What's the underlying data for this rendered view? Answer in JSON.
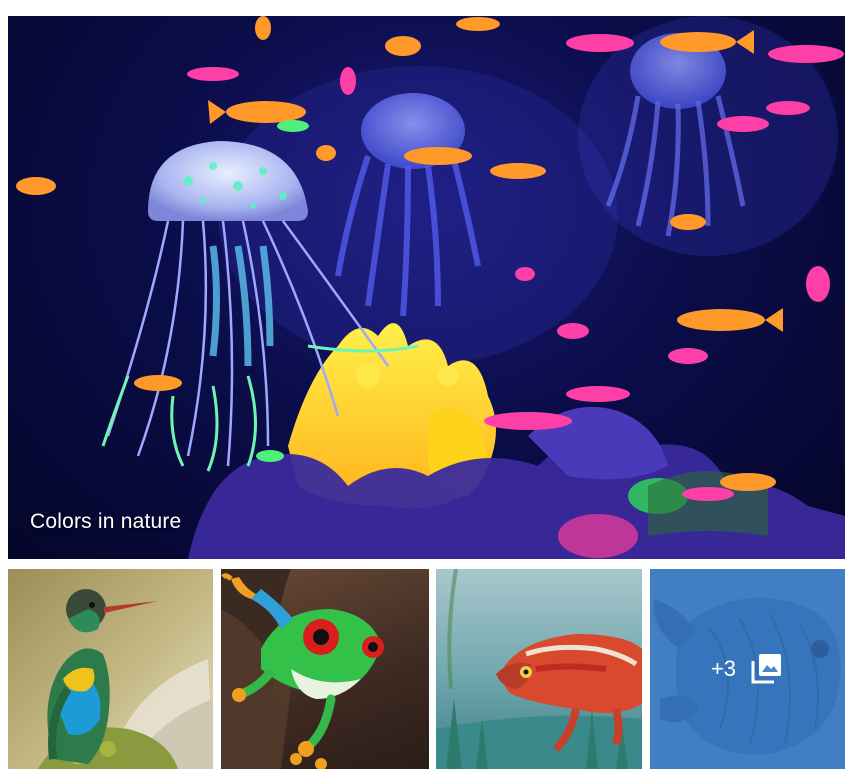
{
  "album": {
    "caption": "Colors in nature",
    "hero_image": "jellyfish-aquarium-photo",
    "thumbnails": [
      {
        "subject": "hummingbird-photo"
      },
      {
        "subject": "tree-frog-photo"
      },
      {
        "subject": "chameleon-photo"
      },
      {
        "subject": "tropical-fish-photo"
      }
    ],
    "more_count": "+3",
    "more_icon": "gallery-icon"
  },
  "colors": {
    "overlay": "#3c78be",
    "hero_background": "#0b0d4a"
  }
}
